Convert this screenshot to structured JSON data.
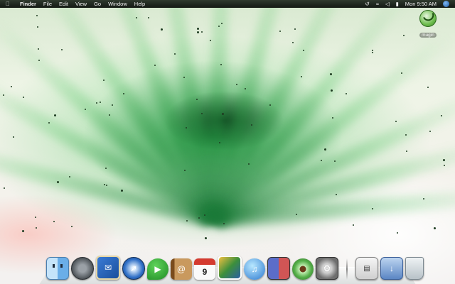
{
  "menubar": {
    "apple_symbol": "",
    "app_name": "Finder",
    "menus": [
      "File",
      "Edit",
      "View",
      "Go",
      "Window",
      "Help"
    ],
    "status": {
      "time_machine_icon": "time-machine-icon",
      "wifi_icon": "wifi-icon",
      "volume_icon": "volume-icon",
      "battery_icon": "battery-icon",
      "clock": "Mon 9:50 AM",
      "spotlight_icon": "spotlight-icon"
    }
  },
  "desktop_icons": [
    {
      "label": "mugin",
      "icon": "hard-drive-icon"
    }
  ],
  "dock": {
    "apps": [
      {
        "name": "finder-icon"
      },
      {
        "name": "dashboard-icon"
      },
      {
        "name": "mail-icon"
      },
      {
        "name": "safari-icon"
      },
      {
        "name": "ichat-icon"
      },
      {
        "name": "address-book-icon"
      },
      {
        "name": "ical-icon",
        "text": "9"
      },
      {
        "name": "iphoto-icon"
      },
      {
        "name": "itunes-icon"
      },
      {
        "name": "spaces-icon"
      },
      {
        "name": "time-machine-icon"
      },
      {
        "name": "system-preferences-icon"
      }
    ],
    "stacks": [
      {
        "name": "documents-stack-icon"
      },
      {
        "name": "downloads-stack-icon"
      },
      {
        "name": "trash-icon"
      }
    ]
  },
  "colors": {
    "menubar_bg": "#141a14",
    "aurora_green": "#1f8c3a"
  }
}
